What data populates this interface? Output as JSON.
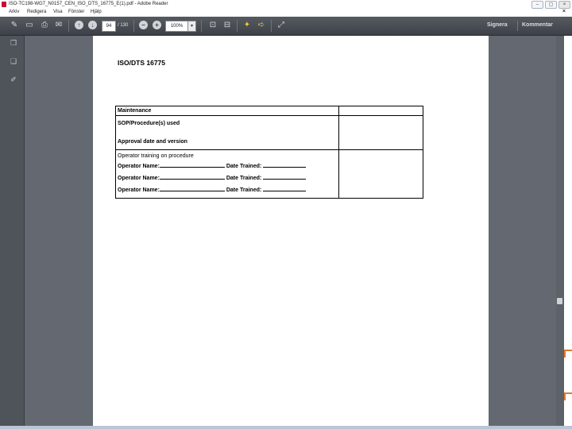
{
  "window": {
    "title": "ISO-TC198-WG7_N0157_CEN_ISO_DTS_16775_E(1).pdf - Adobe Reader",
    "minimize": "–",
    "maximize": "▢",
    "close": "×"
  },
  "menu": {
    "items": [
      "Arkiv",
      "Redigera",
      "Visa",
      "Fönster",
      "Hjälp"
    ],
    "close_doc": "×"
  },
  "toolbar": {
    "page_current": "94",
    "page_total": "/ 130",
    "zoom": "100%",
    "zoom_dropdown": "▾",
    "sign_label": "Signera",
    "comment_label": "Kommentar"
  },
  "document": {
    "heading": "ISO/DTS 16775",
    "table": {
      "row1_left": "Maintenance",
      "row2_left_top": "SOP/Procedure(s) used",
      "row2_left_bottom": "Approval date and version",
      "row3_intro": "Operator training on procedure",
      "operator_label": "Operator Name:",
      "trained_label": "Date Trained:"
    }
  },
  "icons": [
    "edit-icon",
    "save-icon",
    "print-icon",
    "email-icon",
    "prev-page-icon",
    "next-page-icon",
    "zoom-out-icon",
    "zoom-in-icon",
    "fit-page-icon",
    "fit-width-icon",
    "comment-icon",
    "sign-icon",
    "expand-icon",
    "pages-panel-icon",
    "bookmarks-panel-icon",
    "signatures-panel-icon"
  ]
}
